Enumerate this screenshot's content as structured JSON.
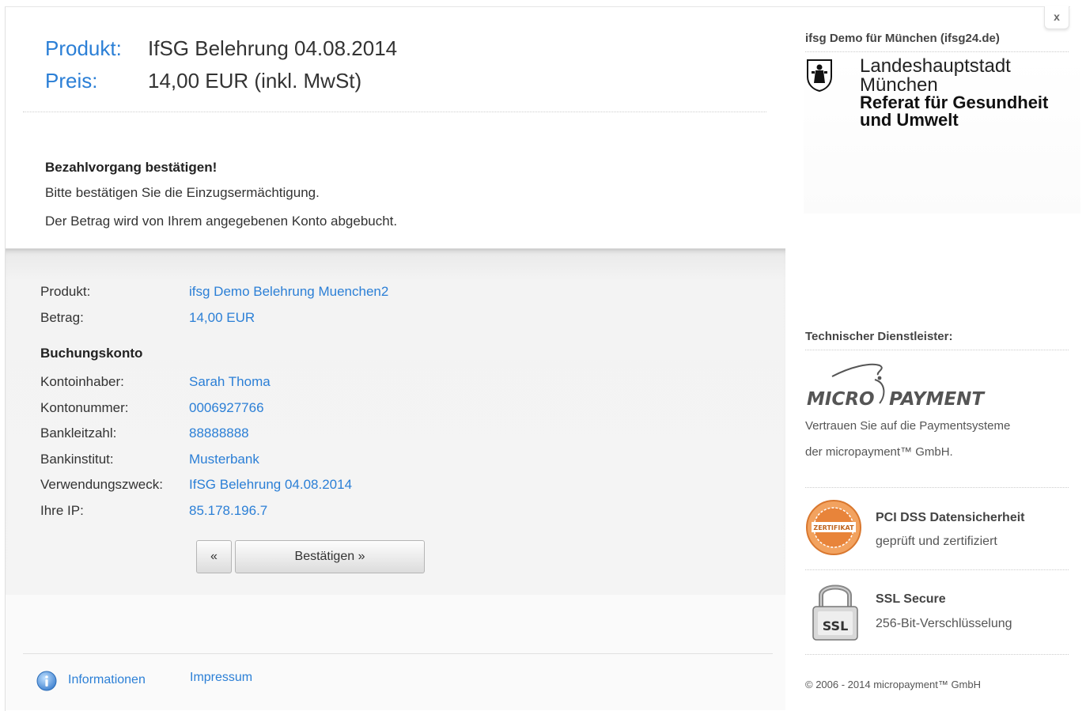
{
  "header": {
    "product_label": "Produkt:",
    "product_value": "IfSG Belehrung 04.08.2014",
    "price_label": "Preis:",
    "price_value": "14,00 EUR (inkl. MwSt)"
  },
  "confirm": {
    "title": "Bezahlvorgang bestätigen!",
    "line1": "Bitte bestätigen Sie die Einzugsermächtigung.",
    "line2": "Der Betrag wird von Ihrem angegebenen Konto abgebucht."
  },
  "details": {
    "product_label": "Produkt:",
    "product_value": "ifsg Demo Belehrung Muenchen2",
    "amount_label": "Betrag:",
    "amount_value": "14,00 EUR",
    "account_title": "Buchungskonto",
    "holder_label": "Kontoinhaber:",
    "holder_value": "Sarah Thoma",
    "accnum_label": "Kontonummer:",
    "accnum_value": "0006927766",
    "blz_label": "Bankleitzahl:",
    "blz_value": "88888888",
    "bank_label": "Bankinstitut:",
    "bank_value": "Musterbank",
    "purpose_label": "Verwendungszweck:",
    "purpose_value": "IfSG Belehrung 04.08.2014",
    "ip_label": "Ihre IP:",
    "ip_value": "85.178.196.7"
  },
  "buttons": {
    "back_label": "«",
    "confirm_label": "Bestätigen »"
  },
  "footer": {
    "info_label": "Informationen",
    "imprint_label": "Impressum"
  },
  "sidebar": {
    "close_label": "x",
    "merchant_title": "ifsg Demo für München (ifsg24.de)",
    "lhm_line1": "Landeshauptstadt",
    "lhm_line2": "München",
    "lhm_line3": "Referat für Gesundheit",
    "lhm_line4": "und Umwelt",
    "provider_title": "Technischer Dienstleister:",
    "logo_micro": "MICRO",
    "logo_payment": "PAYMENT",
    "trust_line1": "Vertrauen Sie auf die Paymentsysteme",
    "trust_line2": "der micropayment™ GmbH.",
    "pci_seal_text": "ZERTIFIKAT",
    "pci_title": "PCI DSS Datensicherheit",
    "pci_sub": "geprüft und zertifiziert",
    "ssl_lock_text": "SSL",
    "ssl_title": "SSL Secure",
    "ssl_sub": "256-Bit-Verschlüsselung",
    "copyright": "© 2006 - 2014 micropayment™ GmbH"
  },
  "colors": {
    "link": "#2b7fd6",
    "seal_orange": "#e8843a"
  }
}
